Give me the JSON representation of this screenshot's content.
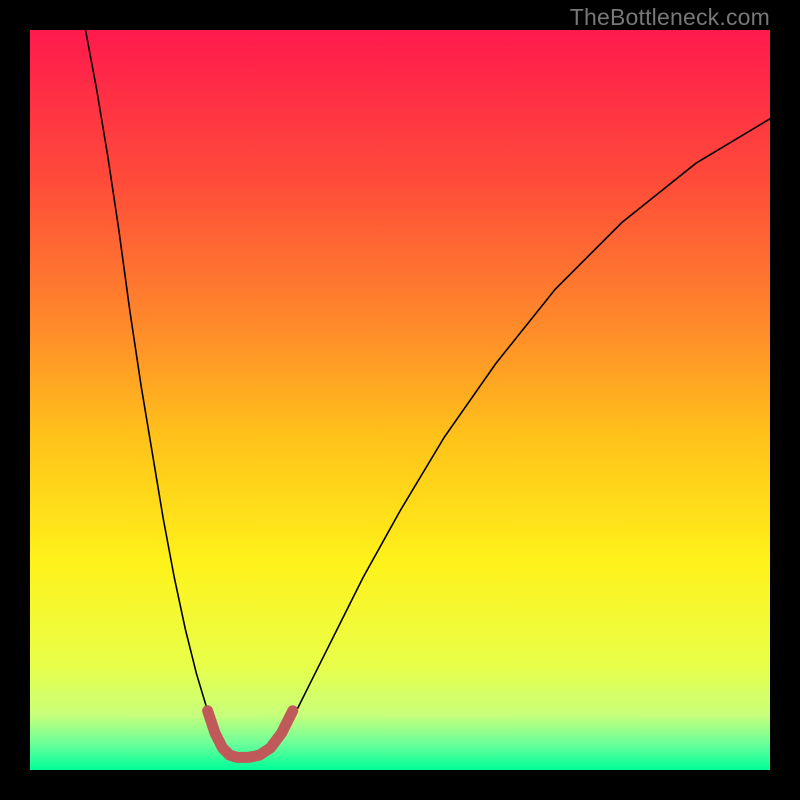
{
  "watermark": "TheBottleneck.com",
  "chart_data": {
    "type": "line",
    "title": "",
    "xlabel": "",
    "ylabel": "",
    "xlim": [
      0,
      100
    ],
    "ylim": [
      0,
      100
    ],
    "axes_visible": false,
    "grid": false,
    "background_gradient": {
      "stops": [
        {
          "offset": 0.0,
          "color": "#ff1a4d"
        },
        {
          "offset": 0.2,
          "color": "#ff4a3a"
        },
        {
          "offset": 0.4,
          "color": "#ff8a2a"
        },
        {
          "offset": 0.55,
          "color": "#ffc21a"
        },
        {
          "offset": 0.72,
          "color": "#fff21a"
        },
        {
          "offset": 0.86,
          "color": "#e8ff4a"
        },
        {
          "offset": 0.925,
          "color": "#c8ff7a"
        },
        {
          "offset": 0.965,
          "color": "#6aff9a"
        },
        {
          "offset": 1.0,
          "color": "#00ff99"
        }
      ]
    },
    "series": [
      {
        "name": "bottleneck-curve",
        "stroke": "#000000",
        "stroke_width": 1.6,
        "points": [
          {
            "x": 7.5,
            "y": 100.0
          },
          {
            "x": 9.0,
            "y": 92.0
          },
          {
            "x": 10.5,
            "y": 83.0
          },
          {
            "x": 12.0,
            "y": 73.0
          },
          {
            "x": 13.5,
            "y": 62.0
          },
          {
            "x": 15.0,
            "y": 52.0
          },
          {
            "x": 16.5,
            "y": 43.0
          },
          {
            "x": 18.0,
            "y": 34.0
          },
          {
            "x": 19.5,
            "y": 26.0
          },
          {
            "x": 21.0,
            "y": 19.0
          },
          {
            "x": 22.5,
            "y": 13.0
          },
          {
            "x": 24.0,
            "y": 8.0
          },
          {
            "x": 25.0,
            "y": 5.0
          },
          {
            "x": 26.0,
            "y": 3.0
          },
          {
            "x": 27.0,
            "y": 2.0
          },
          {
            "x": 28.0,
            "y": 1.7
          },
          {
            "x": 29.5,
            "y": 1.7
          },
          {
            "x": 31.0,
            "y": 2.0
          },
          {
            "x": 32.5,
            "y": 3.0
          },
          {
            "x": 34.0,
            "y": 5.0
          },
          {
            "x": 36.0,
            "y": 8.0
          },
          {
            "x": 38.0,
            "y": 12.0
          },
          {
            "x": 41.0,
            "y": 18.0
          },
          {
            "x": 45.0,
            "y": 26.0
          },
          {
            "x": 50.0,
            "y": 35.0
          },
          {
            "x": 56.0,
            "y": 45.0
          },
          {
            "x": 63.0,
            "y": 55.0
          },
          {
            "x": 71.0,
            "y": 65.0
          },
          {
            "x": 80.0,
            "y": 74.0
          },
          {
            "x": 90.0,
            "y": 82.0
          },
          {
            "x": 100.0,
            "y": 88.0
          }
        ]
      },
      {
        "name": "highlight-valley",
        "stroke": "#c05a5a",
        "stroke_width": 11,
        "linecap": "round",
        "points": [
          {
            "x": 24.0,
            "y": 8.0
          },
          {
            "x": 25.0,
            "y": 5.0
          },
          {
            "x": 26.0,
            "y": 3.0
          },
          {
            "x": 27.0,
            "y": 2.0
          },
          {
            "x": 28.0,
            "y": 1.7
          },
          {
            "x": 29.5,
            "y": 1.7
          },
          {
            "x": 31.0,
            "y": 2.0
          },
          {
            "x": 32.5,
            "y": 3.0
          },
          {
            "x": 34.0,
            "y": 5.0
          },
          {
            "x": 35.5,
            "y": 8.0
          }
        ]
      }
    ]
  }
}
